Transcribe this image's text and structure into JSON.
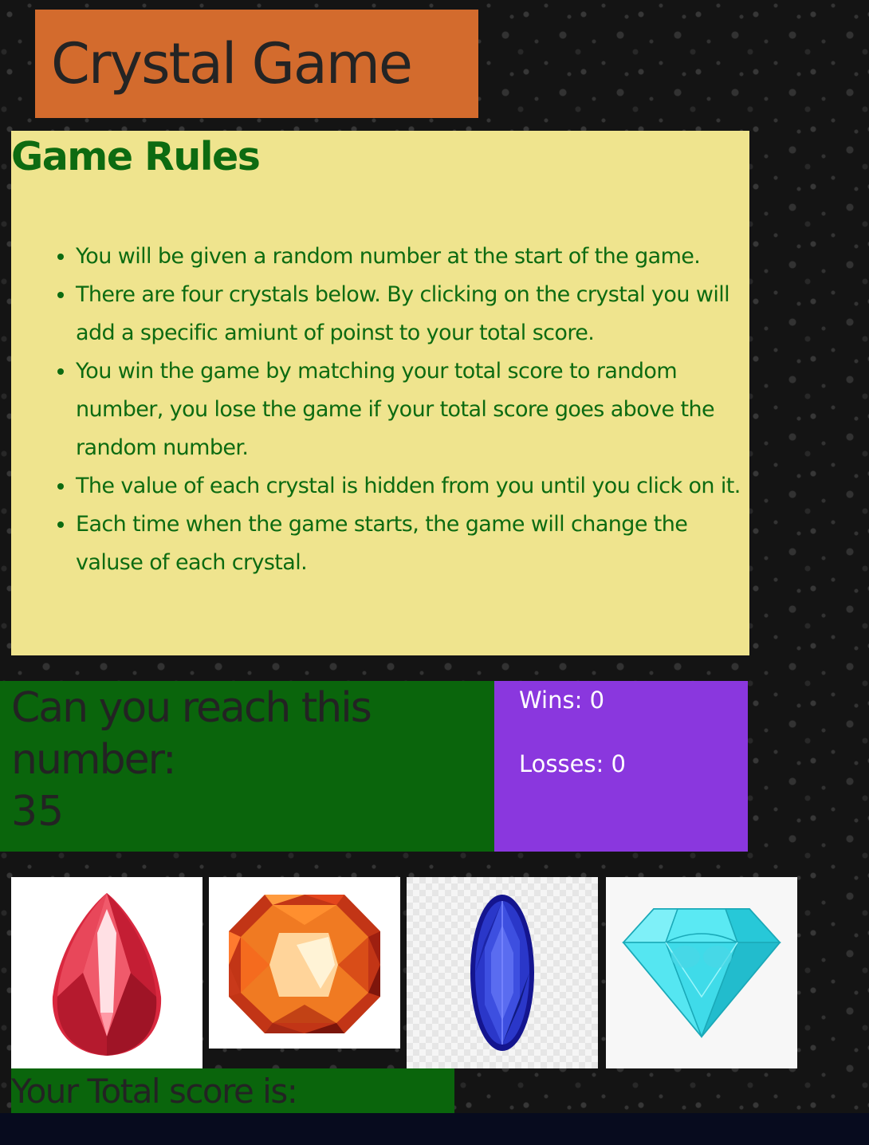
{
  "header": {
    "title": "Crystal Game"
  },
  "rules": {
    "heading": "Game Rules",
    "items": [
      "You will be given a random number at the start of the game.",
      "There are four crystals below. By clicking on the crystal you will add a specific amiunt of poinst to your total score.",
      "You win the game by matching your total score to random number, you lose the game if your total score goes above the random number.",
      "The value of each crystal is hidden from you until you click on it.",
      "Each time when the game starts, the game will change the valuse of each crystal."
    ]
  },
  "target": {
    "label": "Can you reach this number:",
    "number": "35"
  },
  "scoreboard": {
    "wins": "Wins: 0",
    "losses": "Losses: 0"
  },
  "crystals": [
    {
      "icon": "red-teardrop-crystal-icon",
      "color": "#e83a4e"
    },
    {
      "icon": "orange-octagon-crystal-icon",
      "color": "#f07a22"
    },
    {
      "icon": "blue-oval-crystal-icon",
      "color": "#2a37c9"
    },
    {
      "icon": "cyan-diamond-crystal-icon",
      "color": "#3fe2ef"
    }
  ],
  "total": {
    "label": "Your Total score is:"
  },
  "colors": {
    "title_bg": "#d36b2d",
    "rules_bg": "#efe48e",
    "rules_text": "#0d6b11",
    "target_bg": "#0a650c",
    "score_bg": "#8a37de"
  }
}
